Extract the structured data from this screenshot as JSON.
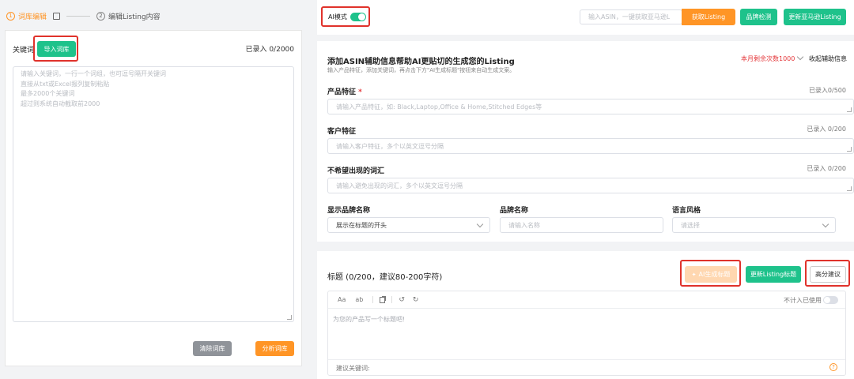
{
  "steps": {
    "step1_num": "1",
    "step1_label": "词库编辑",
    "step2_num": "2",
    "step2_label": "编辑Listing内容"
  },
  "left": {
    "keyword_label": "关键词",
    "import_button": "导入词库",
    "count": "已录入 0/2000",
    "textarea_placeholder": "请输入关键词，一行一个词组，也可逗号隔开关键词\n直接从txt或Excel报列复制粘贴\n最多2000个关键词\n超过则系统自动截取前2000",
    "clear_button": "清除词库",
    "analyze_button": "分析词库"
  },
  "topbar": {
    "ai_mode_label": "AI模式",
    "asin_placeholder": "输入ASIN，一键获取亚马逊L",
    "fetch_button": "获取Listing",
    "brand_check_button": "品牌检测",
    "update_amazon_button": "更新亚马逊Listing"
  },
  "assist": {
    "title": "添加ASIN辅助信息帮助AI更贴切的生成您的Listing",
    "subtitle": "输入产品特征，添加关键词，再点击下方\"AI生成标题\"按钮来自动生成文案。",
    "remaining": "本月剩余次数1000",
    "collapse": "收起辅助信息",
    "feature_label": "产品特征",
    "required_mark": "*",
    "feature_count": "已录入0/500",
    "feature_placeholder": "请输入产品特征，如: Black,Laptop,Office & Home,Stitched Edges等",
    "customer_label": "客户特征",
    "customer_count": "已录入 0/200",
    "customer_placeholder": "请输入客户特征，多个以英文逗号分隔",
    "unwanted_label": "不希望出现的词汇",
    "unwanted_count": "已录入 0/200",
    "unwanted_placeholder": "请输入避免出现的词汇，多个以英文逗号分隔",
    "show_brand_label": "显示品牌名称",
    "show_brand_value": "展示在标题的开头",
    "brand_name_label": "品牌名称",
    "brand_name_placeholder": "请输入名称",
    "language_style_label": "语言风格",
    "language_style_placeholder": "请选择"
  },
  "title_section": {
    "heading": "标题 (0/200，建议80-200字符)",
    "ai_generate_button": "AI生成标题",
    "update_listing_title_button": "更新Listing标题",
    "high_score_button": "高分建议",
    "toolbar_aa": "Aa",
    "toolbar_ab": "ab",
    "exclude_used_label": "不计入已使用",
    "editor_placeholder": "为您的产品写一个标题吧!",
    "suggest_keywords_label": "建议关键词:"
  },
  "colors": {
    "green": "#1ec28b",
    "orange": "#ff9526",
    "gray_button": "#8f9399",
    "red_text": "#e4393c",
    "highlight": "#e0322b"
  }
}
